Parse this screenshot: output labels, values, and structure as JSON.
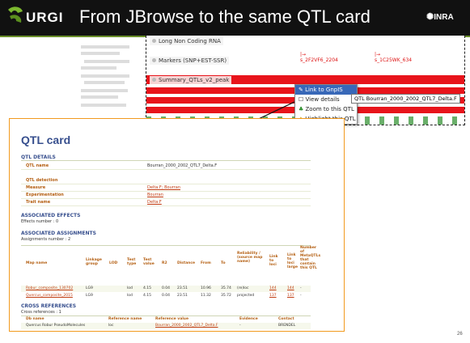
{
  "header": {
    "logo_text": "URGI",
    "title": "From JBrowse to the same  QTL card",
    "partner_logo": "INRA"
  },
  "jbrowse": {
    "tracks": [
      {
        "label": "Long Non Coding RNA"
      },
      {
        "label": "Markers (SNP+EST-SSR)"
      },
      {
        "label": "Summary_QTLs_v2_peak"
      }
    ],
    "markers": [
      "s_2F2VF6_2204",
      "s_1C25WK_634"
    ],
    "context_menu": {
      "header": "Link to GnpIS",
      "items": [
        "View details",
        "Zoom to this QTL",
        "Highlight this QTL"
      ]
    },
    "tooltip": "QTL Bourran_2000_2002_QTL7_Delta.F"
  },
  "card": {
    "title": "QTL card",
    "details_title": "QTL DETAILS",
    "qtl_name_label": "QTL name",
    "qtl_name_value": "Bourran_2000_2002_QTL7_Delta.F",
    "detection_label": "QTL detection",
    "measure_label": "Measure",
    "measure_value": "Delta.F; Bourran",
    "experimentation_label": "Experimentation",
    "experimentation_value": "Bourran",
    "trait_label": "Trait name",
    "trait_value": "Delta.F",
    "effects_title": "ASSOCIATED EFFECTS",
    "effects_count": "Effects number : 0",
    "assign_title": "ASSOCIATED ASSIGNMENTS",
    "assign_count": "Assignments number : 2",
    "assign_headers": [
      "Map name",
      "Linkage group",
      "LOD",
      "Test type",
      "Test value",
      "R2",
      "Distance",
      "From",
      "To",
      "Reliability / (source map name)",
      "Link to loci",
      "Link to loci large",
      "Number of MetaQTLs that contain this QTL"
    ],
    "assign_rows": [
      [
        "Robur_composite_130702",
        "LG9",
        "",
        "lod",
        "4.15",
        "0.04",
        "23.51",
        "10.96",
        "35.74",
        "(re)loc",
        "144",
        "144",
        "-"
      ],
      [
        "Quercus_composite_2015",
        "LG9",
        "",
        "lod",
        "4.15",
        "0.04",
        "23.51",
        "11.32",
        "35.72",
        "projected",
        "137",
        "137",
        "-"
      ]
    ],
    "xref_title": "CROSS REFERENCES",
    "xref_count": "Cross references : 1",
    "xref_headers": [
      "Db name",
      "Reference name",
      "Reference value",
      "Evidence",
      "Contact"
    ],
    "xref_rows": [
      [
        "Quercus Robur PseudoMolecules",
        "loc",
        "Bourran_2000_2002_QTL7_Delta.F",
        "-",
        "BRENDEL"
      ]
    ]
  },
  "slide_number": "26"
}
